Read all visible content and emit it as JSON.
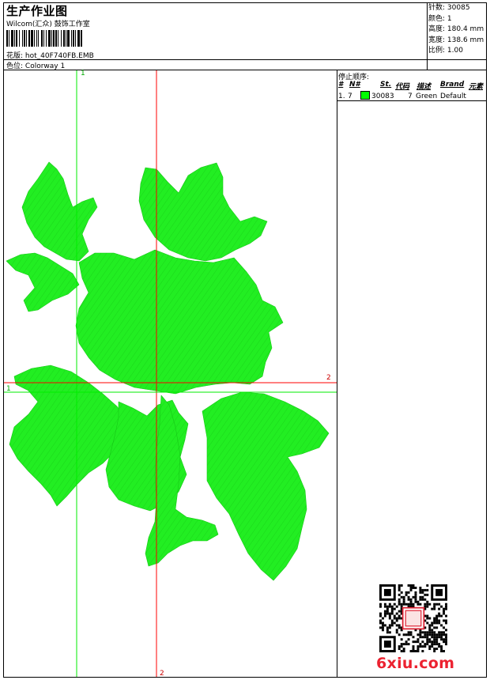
{
  "header": {
    "title": "生产作业图",
    "company": "Wilcom(汇众)  鼓饰工作室",
    "design_file_label": "花版:",
    "design_file": "hot_40F740FB.EMB",
    "colorway_label": "色位:",
    "colorway": "Colorway 1"
  },
  "stats": {
    "stitches_label": "针数:",
    "stitches": "30085",
    "colors_label": "颜色:",
    "colors": "1",
    "height_label": "高度:",
    "height": "180.4 mm",
    "width_label": "宽度:",
    "width": "138.6 mm",
    "scale_label": "比例:",
    "scale": "1.00"
  },
  "stop_sequence": {
    "title": "停止顺序:",
    "headers": [
      "#",
      "N#",
      "St.",
      "代码",
      "描述",
      "Brand",
      "元素"
    ],
    "rows": [
      {
        "index": "1.",
        "needle": "7",
        "code": "30083",
        "stitches": "7",
        "description": "Green",
        "brand": "Default",
        "swatch_color": "#00ff00"
      }
    ]
  },
  "design": {
    "fill_color": "#22ee22",
    "guide_green": "#00ee00",
    "guide_red": "#ff0000",
    "markers": {
      "v_green": "1",
      "v_red": "2",
      "h_green": "1",
      "h_red": "2",
      "bottom_red": "2"
    }
  },
  "watermark": {
    "site": "6xiu.com",
    "qr_icon": "qr-code-icon"
  }
}
